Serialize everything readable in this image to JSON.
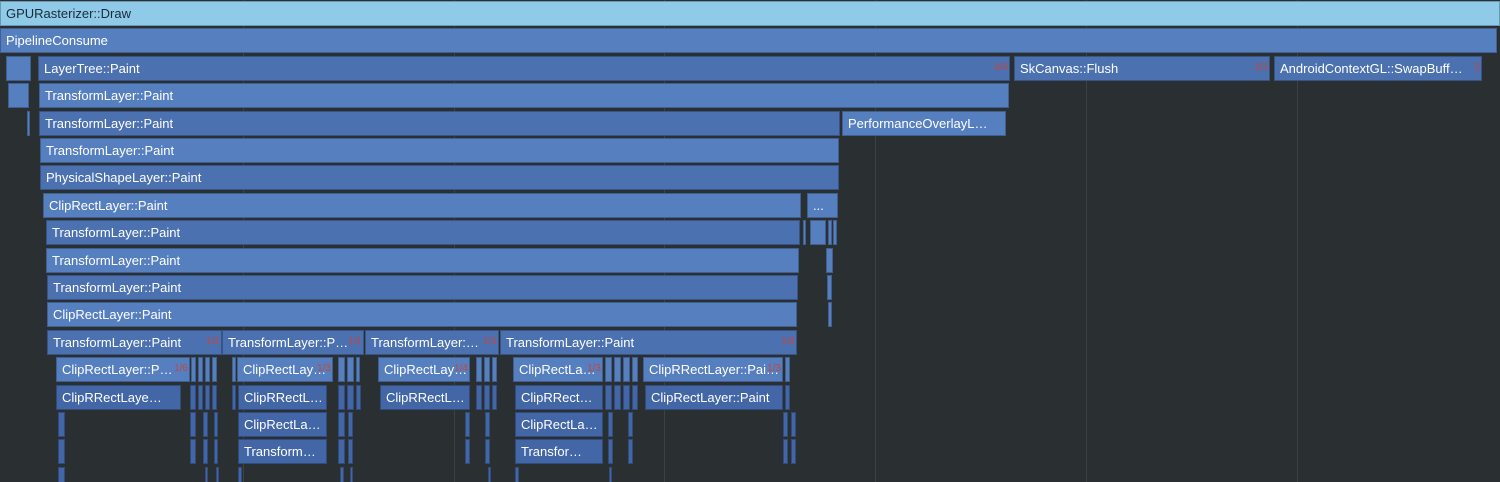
{
  "colors": {
    "background": "#2a2f31",
    "top_frame": "#8fcbe8",
    "frame_a": "#4b71b0",
    "frame_b": "#567fbf",
    "frame_c": "#4266a6",
    "badge": "#c8453a"
  },
  "frames": [
    {
      "id": "gpurasterizer-draw",
      "label": "GPURasterizer::Draw",
      "level": 0,
      "start": 0,
      "end": 1500,
      "tone": "top"
    },
    {
      "id": "pipelineconsume",
      "label": "PipelineConsume",
      "level": 1,
      "start": 0,
      "end": 1497,
      "tone": "b"
    },
    {
      "id": "l2-a",
      "label": "",
      "level": 2,
      "start": 6,
      "end": 31,
      "tone": "b"
    },
    {
      "id": "layertree-paint",
      "label": "LayerTree::Paint",
      "level": 2,
      "start": 38,
      "end": 1010,
      "tone": "a",
      "badge": "4/4"
    },
    {
      "id": "skcanvas-flush",
      "label": "SkCanvas::Flush",
      "level": 2,
      "start": 1014,
      "end": 1270,
      "tone": "a",
      "badge": "1/3"
    },
    {
      "id": "androidcontextgl-swapbuff",
      "label": "AndroidContextGL::SwapBuff…",
      "level": 2,
      "start": 1274,
      "end": 1482,
      "tone": "a",
      "badge": "2"
    },
    {
      "id": "l3-a",
      "label": "",
      "level": 3,
      "start": 8,
      "end": 29,
      "tone": "b"
    },
    {
      "id": "transformlayer-paint-1",
      "label": "TransformLayer::Paint",
      "level": 3,
      "start": 39,
      "end": 1009,
      "tone": "b"
    },
    {
      "id": "l4-a",
      "label": "",
      "level": 4,
      "start": 27,
      "end": 30,
      "tone": "b"
    },
    {
      "id": "transformlayer-paint-2",
      "label": "TransformLayer::Paint",
      "level": 4,
      "start": 39,
      "end": 840,
      "tone": "a"
    },
    {
      "id": "performanceoverlay",
      "label": "PerformanceOverlayL…",
      "level": 4,
      "start": 842,
      "end": 1006,
      "tone": "b"
    },
    {
      "id": "transformlayer-paint-3",
      "label": "TransformLayer::Paint",
      "level": 5,
      "start": 40,
      "end": 839,
      "tone": "b"
    },
    {
      "id": "physicalshapelayer-paint",
      "label": "PhysicalShapeLayer::Paint",
      "level": 6,
      "start": 40,
      "end": 839,
      "tone": "a"
    },
    {
      "id": "cliprectlayer-paint-1",
      "label": "ClipRectLayer::Paint",
      "level": 7,
      "start": 43,
      "end": 801,
      "tone": "b"
    },
    {
      "id": "l7-dots",
      "label": "...",
      "level": 7,
      "start": 807,
      "end": 838,
      "tone": "b"
    },
    {
      "id": "transformlayer-paint-4",
      "label": "TransformLayer::Paint",
      "level": 8,
      "start": 46,
      "end": 800,
      "tone": "a"
    },
    {
      "id": "l8-b",
      "label": "",
      "level": 8,
      "start": 803,
      "end": 806,
      "tone": "b"
    },
    {
      "id": "l8-c",
      "label": "",
      "level": 8,
      "start": 810,
      "end": 826,
      "tone": "b"
    },
    {
      "id": "l8-d",
      "label": "",
      "level": 8,
      "start": 828,
      "end": 832,
      "tone": "b"
    },
    {
      "id": "l8-e",
      "label": "",
      "level": 8,
      "start": 833,
      "end": 837,
      "tone": "b"
    },
    {
      "id": "transformlayer-paint-5",
      "label": "TransformLayer::Paint",
      "level": 9,
      "start": 46,
      "end": 799,
      "tone": "b"
    },
    {
      "id": "l9-b",
      "label": "",
      "level": 9,
      "start": 826,
      "end": 833,
      "tone": "b"
    },
    {
      "id": "transformlayer-paint-6",
      "label": "TransformLayer::Paint",
      "level": 10,
      "start": 47,
      "end": 798,
      "tone": "a"
    },
    {
      "id": "l10-b",
      "label": "",
      "level": 10,
      "start": 827,
      "end": 832,
      "tone": "b"
    },
    {
      "id": "cliprectlayer-paint-2",
      "label": "ClipRectLayer::Paint",
      "level": 11,
      "start": 47,
      "end": 797,
      "tone": "b"
    },
    {
      "id": "l11-b",
      "label": "",
      "level": 11,
      "start": 828,
      "end": 832,
      "tone": "b"
    },
    {
      "id": "transformlayer-paint-7",
      "label": "TransformLayer::Paint",
      "level": 12,
      "start": 47,
      "end": 222,
      "tone": "a",
      "badge": "1/1"
    },
    {
      "id": "transformlayer-p",
      "label": "TransformLayer::P…",
      "level": 12,
      "start": 222,
      "end": 364,
      "tone": "a",
      "badge": "1/1"
    },
    {
      "id": "transformlayer-ellipsis-1",
      "label": "TransformLayer:…",
      "level": 12,
      "start": 365,
      "end": 499,
      "tone": "a",
      "badge": "1/1"
    },
    {
      "id": "transformlayer-paint-8",
      "label": "TransformLayer::Paint",
      "level": 12,
      "start": 500,
      "end": 797,
      "tone": "a",
      "badge": "1/4"
    },
    {
      "id": "cliprectlayer-p",
      "label": "ClipRectLayer::P…",
      "level": 13,
      "start": 56,
      "end": 190,
      "tone": "b",
      "badge": "1/6"
    },
    {
      "id": "l13-a2",
      "label": "",
      "level": 13,
      "start": 191,
      "end": 196,
      "tone": "b"
    },
    {
      "id": "l13-a3",
      "label": "",
      "level": 13,
      "start": 198,
      "end": 203,
      "tone": "b"
    },
    {
      "id": "l13-a4",
      "label": "",
      "level": 13,
      "start": 205,
      "end": 210,
      "tone": "b"
    },
    {
      "id": "l13-a5",
      "label": "",
      "level": 13,
      "start": 212,
      "end": 217,
      "tone": "b"
    },
    {
      "id": "l13-b0",
      "label": "",
      "level": 13,
      "start": 232,
      "end": 236,
      "tone": "b"
    },
    {
      "id": "cliprectlay-1",
      "label": "ClipRectLay…",
      "level": 13,
      "start": 237,
      "end": 333,
      "tone": "b",
      "badge": "1/3"
    },
    {
      "id": "l13-b2",
      "label": "",
      "level": 13,
      "start": 338,
      "end": 345,
      "tone": "b"
    },
    {
      "id": "l13-b3",
      "label": "",
      "level": 13,
      "start": 347,
      "end": 354,
      "tone": "b"
    },
    {
      "id": "l13-b4",
      "label": "",
      "level": 13,
      "start": 356,
      "end": 360,
      "tone": "b"
    },
    {
      "id": "cliprectlay-2",
      "label": "ClipRectLay…",
      "level": 13,
      "start": 378,
      "end": 470,
      "tone": "b",
      "badge": "1/4"
    },
    {
      "id": "l13-c2",
      "label": "",
      "level": 13,
      "start": 476,
      "end": 482,
      "tone": "b"
    },
    {
      "id": "l13-c3",
      "label": "",
      "level": 13,
      "start": 484,
      "end": 490,
      "tone": "b"
    },
    {
      "id": "l13-c4",
      "label": "",
      "level": 13,
      "start": 492,
      "end": 497,
      "tone": "b"
    },
    {
      "id": "cliprectla-1",
      "label": "ClipRectLa…",
      "level": 13,
      "start": 513,
      "end": 603,
      "tone": "b",
      "badge": "1/3"
    },
    {
      "id": "l13-d2",
      "label": "",
      "level": 13,
      "start": 605,
      "end": 612,
      "tone": "b"
    },
    {
      "id": "l13-d3",
      "label": "",
      "level": 13,
      "start": 614,
      "end": 621,
      "tone": "b"
    },
    {
      "id": "l13-d4",
      "label": "",
      "level": 13,
      "start": 623,
      "end": 630,
      "tone": "b"
    },
    {
      "id": "l13-d5",
      "label": "",
      "level": 13,
      "start": 632,
      "end": 638,
      "tone": "b"
    },
    {
      "id": "cliprrectlayer-pai",
      "label": "ClipRRectLayer::Pai…",
      "level": 13,
      "start": 643,
      "end": 783,
      "tone": "b",
      "badge": "1/3"
    },
    {
      "id": "l13-e2",
      "label": "",
      "level": 13,
      "start": 785,
      "end": 790,
      "tone": "b"
    },
    {
      "id": "cliprrectlaye",
      "label": "ClipRRectLaye…",
      "level": 14,
      "start": 56,
      "end": 181,
      "tone": "c"
    },
    {
      "id": "l14-a2",
      "label": "",
      "level": 14,
      "start": 190,
      "end": 196,
      "tone": "c"
    },
    {
      "id": "l14-a3",
      "label": "",
      "level": 14,
      "start": 198,
      "end": 203,
      "tone": "c"
    },
    {
      "id": "l14-a4",
      "label": "",
      "level": 14,
      "start": 205,
      "end": 210,
      "tone": "c"
    },
    {
      "id": "l14-a5",
      "label": "",
      "level": 14,
      "start": 212,
      "end": 217,
      "tone": "c"
    },
    {
      "id": "l14-b0",
      "label": "",
      "level": 14,
      "start": 232,
      "end": 236,
      "tone": "c"
    },
    {
      "id": "cliprrectl-1",
      "label": "ClipRRectL…",
      "level": 14,
      "start": 238,
      "end": 327,
      "tone": "c"
    },
    {
      "id": "l14-b2",
      "label": "",
      "level": 14,
      "start": 338,
      "end": 345,
      "tone": "c"
    },
    {
      "id": "l14-b3",
      "label": "",
      "level": 14,
      "start": 347,
      "end": 354,
      "tone": "c"
    },
    {
      "id": "l14-b4",
      "label": "",
      "level": 14,
      "start": 356,
      "end": 361,
      "tone": "c"
    },
    {
      "id": "cliprrectl-2",
      "label": "ClipRRectL…",
      "level": 14,
      "start": 380,
      "end": 470,
      "tone": "c"
    },
    {
      "id": "l14-c2",
      "label": "",
      "level": 14,
      "start": 476,
      "end": 482,
      "tone": "c"
    },
    {
      "id": "l14-c3",
      "label": "",
      "level": 14,
      "start": 484,
      "end": 490,
      "tone": "c"
    },
    {
      "id": "l14-c4",
      "label": "",
      "level": 14,
      "start": 492,
      "end": 497,
      "tone": "c"
    },
    {
      "id": "cliprrect-1",
      "label": "ClipRRect…",
      "level": 14,
      "start": 515,
      "end": 603,
      "tone": "c"
    },
    {
      "id": "l14-d2",
      "label": "",
      "level": 14,
      "start": 605,
      "end": 612,
      "tone": "c"
    },
    {
      "id": "l14-d3",
      "label": "",
      "level": 14,
      "start": 614,
      "end": 621,
      "tone": "c"
    },
    {
      "id": "l14-d4",
      "label": "",
      "level": 14,
      "start": 623,
      "end": 630,
      "tone": "c"
    },
    {
      "id": "l14-d5",
      "label": "",
      "level": 14,
      "start": 632,
      "end": 638,
      "tone": "c"
    },
    {
      "id": "cliprectlayer-paint-3",
      "label": "ClipRectLayer::Paint",
      "level": 14,
      "start": 645,
      "end": 783,
      "tone": "c"
    },
    {
      "id": "l14-e2",
      "label": "",
      "level": 14,
      "start": 785,
      "end": 790,
      "tone": "c"
    },
    {
      "id": "l15-a1",
      "label": "",
      "level": 15,
      "start": 58,
      "end": 65,
      "tone": "c"
    },
    {
      "id": "l15-a2",
      "label": "",
      "level": 15,
      "start": 190,
      "end": 196,
      "tone": "c"
    },
    {
      "id": "l15-a3",
      "label": "",
      "level": 15,
      "start": 203,
      "end": 208,
      "tone": "c"
    },
    {
      "id": "l15-a4",
      "label": "",
      "level": 15,
      "start": 214,
      "end": 218,
      "tone": "c"
    },
    {
      "id": "cliprectla-2",
      "label": "ClipRectLa…",
      "level": 15,
      "start": 238,
      "end": 327,
      "tone": "c"
    },
    {
      "id": "l15-b2",
      "label": "",
      "level": 15,
      "start": 338,
      "end": 345,
      "tone": "c"
    },
    {
      "id": "l15-b3",
      "label": "",
      "level": 15,
      "start": 348,
      "end": 353,
      "tone": "c"
    },
    {
      "id": "l15-c1",
      "label": "",
      "level": 15,
      "start": 465,
      "end": 470,
      "tone": "c"
    },
    {
      "id": "l15-c2",
      "label": "",
      "level": 15,
      "start": 485,
      "end": 490,
      "tone": "c"
    },
    {
      "id": "cliprectla-3",
      "label": "ClipRectLa…",
      "level": 15,
      "start": 515,
      "end": 603,
      "tone": "c"
    },
    {
      "id": "l15-d2",
      "label": "",
      "level": 15,
      "start": 608,
      "end": 613,
      "tone": "c"
    },
    {
      "id": "l15-d3",
      "label": "",
      "level": 15,
      "start": 628,
      "end": 633,
      "tone": "c"
    },
    {
      "id": "l15-e1",
      "label": "",
      "level": 15,
      "start": 783,
      "end": 788,
      "tone": "c"
    },
    {
      "id": "l15-e2",
      "label": "",
      "level": 15,
      "start": 791,
      "end": 796,
      "tone": "c"
    },
    {
      "id": "l16-a1",
      "label": "",
      "level": 16,
      "start": 58,
      "end": 65,
      "tone": "c"
    },
    {
      "id": "l16-a2",
      "label": "",
      "level": 16,
      "start": 190,
      "end": 196,
      "tone": "c"
    },
    {
      "id": "l16-a3",
      "label": "",
      "level": 16,
      "start": 203,
      "end": 208,
      "tone": "c"
    },
    {
      "id": "l16-a4",
      "label": "",
      "level": 16,
      "start": 214,
      "end": 218,
      "tone": "c"
    },
    {
      "id": "transform-ellipsis-1",
      "label": "Transform…",
      "level": 16,
      "start": 238,
      "end": 327,
      "tone": "c"
    },
    {
      "id": "l16-b2",
      "label": "",
      "level": 16,
      "start": 338,
      "end": 345,
      "tone": "c"
    },
    {
      "id": "l16-b3",
      "label": "",
      "level": 16,
      "start": 348,
      "end": 353,
      "tone": "c"
    },
    {
      "id": "l16-c1",
      "label": "",
      "level": 16,
      "start": 465,
      "end": 470,
      "tone": "c"
    },
    {
      "id": "l16-c2",
      "label": "",
      "level": 16,
      "start": 485,
      "end": 490,
      "tone": "c"
    },
    {
      "id": "transfor-ellipsis",
      "label": "Transfor…",
      "level": 16,
      "start": 515,
      "end": 603,
      "tone": "c"
    },
    {
      "id": "l16-d2",
      "label": "",
      "level": 16,
      "start": 608,
      "end": 613,
      "tone": "c"
    },
    {
      "id": "l16-d3",
      "label": "",
      "level": 16,
      "start": 628,
      "end": 633,
      "tone": "c"
    },
    {
      "id": "l16-e1",
      "label": "",
      "level": 16,
      "start": 783,
      "end": 788,
      "tone": "c"
    },
    {
      "id": "l16-e2",
      "label": "",
      "level": 16,
      "start": 791,
      "end": 796,
      "tone": "c"
    },
    {
      "id": "l17-a1",
      "label": "",
      "level": 17,
      "start": 58,
      "end": 65,
      "tone": "c"
    },
    {
      "id": "l17-a2",
      "label": "",
      "level": 17,
      "start": 205,
      "end": 208,
      "tone": "c"
    },
    {
      "id": "l17-a3",
      "label": "",
      "level": 17,
      "start": 216,
      "end": 219,
      "tone": "c"
    },
    {
      "id": "l17-b1",
      "label": "",
      "level": 17,
      "start": 238,
      "end": 242,
      "tone": "c"
    },
    {
      "id": "l17-b2",
      "label": "",
      "level": 17,
      "start": 340,
      "end": 344,
      "tone": "c"
    },
    {
      "id": "l17-b3",
      "label": "",
      "level": 17,
      "start": 350,
      "end": 353,
      "tone": "c"
    },
    {
      "id": "l17-c1",
      "label": "",
      "level": 17,
      "start": 488,
      "end": 491,
      "tone": "c"
    },
    {
      "id": "l17-d1",
      "label": "",
      "level": 17,
      "start": 515,
      "end": 519,
      "tone": "c"
    },
    {
      "id": "l17-d2",
      "label": "",
      "level": 17,
      "start": 609,
      "end": 612,
      "tone": "c"
    }
  ]
}
